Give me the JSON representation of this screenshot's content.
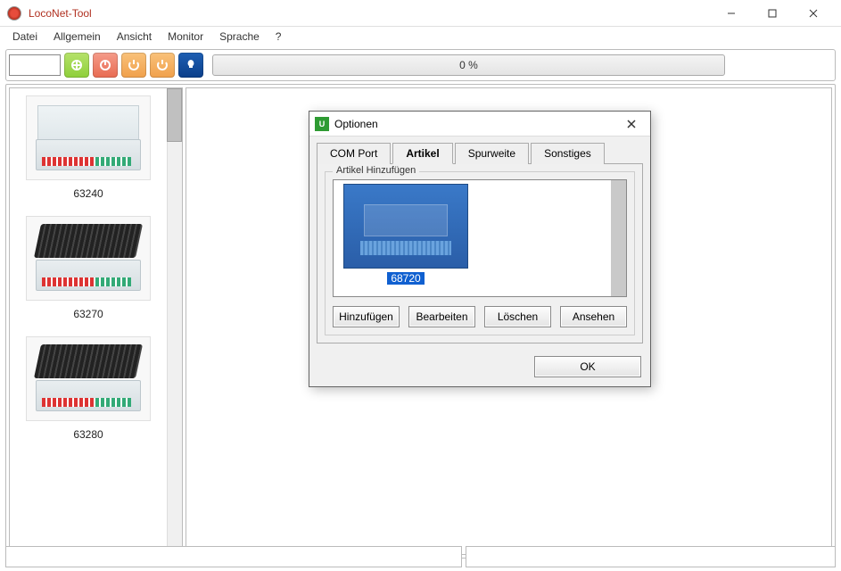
{
  "window": {
    "title": "LocoNet-Tool"
  },
  "menu": {
    "items": [
      "Datei",
      "Allgemein",
      "Ansicht",
      "Monitor",
      "Sprache",
      "?"
    ]
  },
  "toolbar": {
    "progress_text": "0 %"
  },
  "sidebar": {
    "products": [
      {
        "id": "63240"
      },
      {
        "id": "63270"
      },
      {
        "id": "63280"
      }
    ]
  },
  "dialog": {
    "title": "Optionen",
    "tabs": {
      "com": "COM Port",
      "artikel": "Artikel",
      "spurweite": "Spurweite",
      "sonstiges": "Sonstiges"
    },
    "active_tab": "artikel",
    "group_label": "Artikel Hinzufügen",
    "selected_item": {
      "id": "68720"
    },
    "buttons": {
      "add": "Hinzufügen",
      "edit": "Bearbeiten",
      "del": "Löschen",
      "view": "Ansehen",
      "ok": "OK"
    }
  }
}
